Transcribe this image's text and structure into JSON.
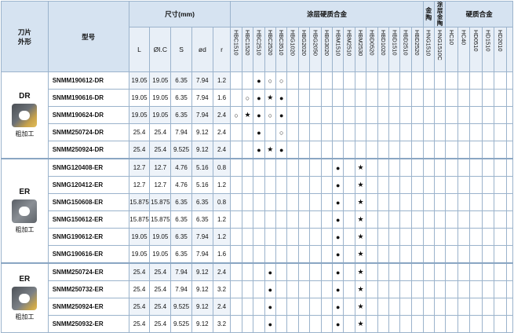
{
  "header": {
    "shape_label": "刀片\n外形",
    "model_label": "型号",
    "dimensions_label": "尺寸(mm)",
    "coated_label": "涂层硬质合金",
    "cermet_label": "金\n陶",
    "coated_cermet_label": "涂层\n金陶",
    "carbide_label": "硬质合金",
    "dim_cols": [
      "L",
      "ØI.C",
      "S",
      "ød",
      "r"
    ],
    "coated_grades": [
      "HBC1510",
      "HBC1520",
      "HBC2510",
      "HBC2520",
      "HBC3510",
      "HBG1020",
      "HBG2020",
      "HBG2050",
      "HBG3020",
      "HBM1510",
      "HBM2510",
      "HBM2530",
      "HBD0520",
      "HBD1020",
      "HBD1510",
      "HBD2510",
      "HBD2520"
    ],
    "cermet_grades": [
      "HNG1510"
    ],
    "coated_cermet_grades": [
      "HNG1510C"
    ],
    "carbide_grades": [
      "HC10",
      "HC40",
      "HD0510",
      "HD1510",
      "HD2010"
    ]
  },
  "groups": [
    {
      "code": "DR",
      "label": "粗加工",
      "rows": [
        {
          "model": "SNMM190612-DR",
          "dims": [
            "19.05",
            "19.05",
            "6.35",
            "7.94",
            "1.2"
          ],
          "marks": {
            "2": "●",
            "3": "○",
            "4": "○"
          }
        },
        {
          "model": "SNMM190616-DR",
          "dims": [
            "19.05",
            "19.05",
            "6.35",
            "7.94",
            "1.6"
          ],
          "marks": {
            "1": "○",
            "2": "●",
            "3": "★",
            "4": "●"
          }
        },
        {
          "model": "SNMM190624-DR",
          "dims": [
            "19.05",
            "19.05",
            "6.35",
            "7.94",
            "2.4"
          ],
          "marks": {
            "0": "○",
            "1": "★",
            "2": "●",
            "3": "○",
            "4": "●"
          }
        },
        {
          "model": "SNMM250724-DR",
          "dims": [
            "25.4",
            "25.4",
            "7.94",
            "9.12",
            "2.4"
          ],
          "marks": {
            "2": "●",
            "4": "○"
          }
        },
        {
          "model": "SNMM250924-DR",
          "dims": [
            "25.4",
            "25.4",
            "9.525",
            "9.12",
            "2.4"
          ],
          "marks": {
            "2": "●",
            "3": "★",
            "4": "●"
          }
        }
      ]
    },
    {
      "code": "ER",
      "label": "粗加工",
      "rows": [
        {
          "model": "SNMG120408-ER",
          "dims": [
            "12.7",
            "12.7",
            "4.76",
            "5.16",
            "0.8"
          ],
          "marks": {
            "9": "●",
            "11": "★"
          }
        },
        {
          "model": "SNMG120412-ER",
          "dims": [
            "12.7",
            "12.7",
            "4.76",
            "5.16",
            "1.2"
          ],
          "marks": {
            "9": "●",
            "11": "★"
          }
        },
        {
          "model": "SNMG150608-ER",
          "dims": [
            "15.875",
            "15.875",
            "6.35",
            "6.35",
            "0.8"
          ],
          "marks": {
            "9": "●",
            "11": "★"
          }
        },
        {
          "model": "SNMG150612-ER",
          "dims": [
            "15.875",
            "15.875",
            "6.35",
            "6.35",
            "1.2"
          ],
          "marks": {
            "9": "●",
            "11": "★"
          }
        },
        {
          "model": "SNMG190612-ER",
          "dims": [
            "19.05",
            "19.05",
            "6.35",
            "7.94",
            "1.2"
          ],
          "marks": {
            "9": "●",
            "11": "★"
          }
        },
        {
          "model": "SNMG190616-ER",
          "dims": [
            "19.05",
            "19.05",
            "6.35",
            "7.94",
            "1.6"
          ],
          "marks": {
            "9": "●",
            "11": "★"
          }
        }
      ]
    },
    {
      "code": "ER",
      "label": "粗加工",
      "rows": [
        {
          "model": "SNMM250724-ER",
          "dims": [
            "25.4",
            "25.4",
            "7.94",
            "9.12",
            "2.4"
          ],
          "marks": {
            "3": "●",
            "9": "●",
            "11": "★"
          }
        },
        {
          "model": "SNMM250732-ER",
          "dims": [
            "25.4",
            "25.4",
            "7.94",
            "9.12",
            "3.2"
          ],
          "marks": {
            "3": "●",
            "9": "●",
            "11": "★"
          }
        },
        {
          "model": "SNMM250924-ER",
          "dims": [
            "25.4",
            "25.4",
            "9.525",
            "9.12",
            "2.4"
          ],
          "marks": {
            "3": "●",
            "9": "●",
            "11": "★"
          }
        },
        {
          "model": "SNMM250932-ER",
          "dims": [
            "25.4",
            "25.4",
            "9.525",
            "9.12",
            "3.2"
          ],
          "marks": {
            "3": "●",
            "9": "●",
            "11": "★"
          }
        }
      ]
    }
  ]
}
